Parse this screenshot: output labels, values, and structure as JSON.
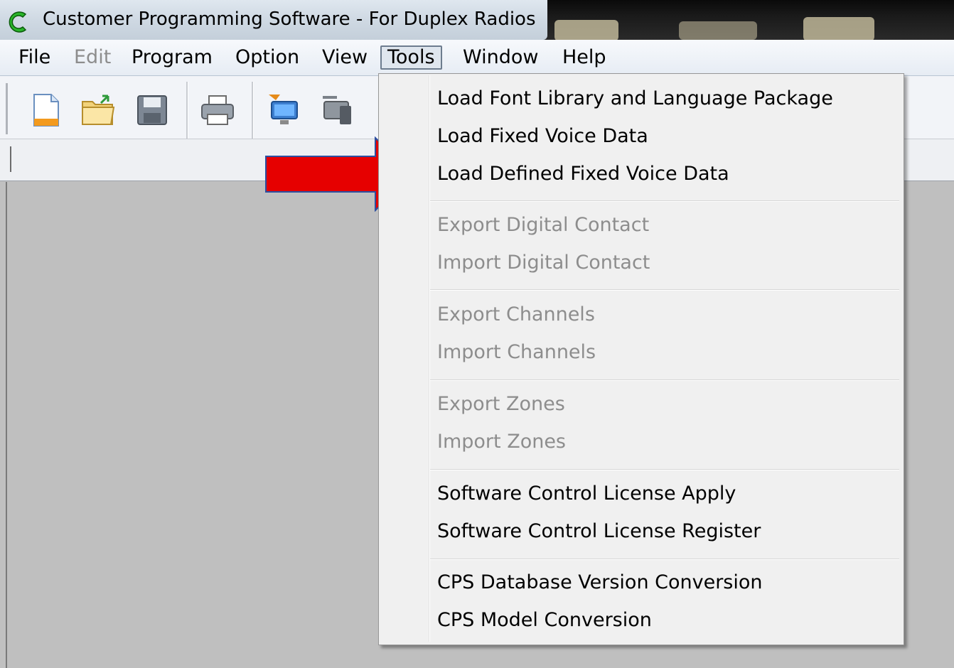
{
  "window": {
    "title": "Customer Programming Software - For Duplex Radios"
  },
  "menubar": {
    "items": [
      {
        "label": "File",
        "enabled": true
      },
      {
        "label": "Edit",
        "enabled": false
      },
      {
        "label": "Program",
        "enabled": true
      },
      {
        "label": "Option",
        "enabled": true
      },
      {
        "label": "View",
        "enabled": true
      },
      {
        "label": "Tools",
        "enabled": true,
        "active": true
      },
      {
        "label": "Window",
        "enabled": true
      },
      {
        "label": "Help",
        "enabled": true
      }
    ]
  },
  "toolbar": {
    "buttons": [
      "new-file-icon",
      "open-folder-icon",
      "save-icon",
      "print-icon",
      "read-from-radio-icon",
      "write-to-radio-icon"
    ]
  },
  "tools_menu": {
    "groups": [
      [
        {
          "label": "Load Font Library and Language Package",
          "enabled": true
        },
        {
          "label": "Load Fixed Voice Data",
          "enabled": true
        },
        {
          "label": "Load Defined Fixed Voice Data",
          "enabled": true
        }
      ],
      [
        {
          "label": "Export Digital Contact",
          "enabled": false
        },
        {
          "label": "Import Digital Contact",
          "enabled": false
        }
      ],
      [
        {
          "label": "Export Channels",
          "enabled": false
        },
        {
          "label": "Import Channels",
          "enabled": false
        }
      ],
      [
        {
          "label": "Export Zones",
          "enabled": false
        },
        {
          "label": "Import Zones",
          "enabled": false
        }
      ],
      [
        {
          "label": "Software Control License Apply",
          "enabled": true
        },
        {
          "label": "Software Control License Register",
          "enabled": true
        }
      ],
      [
        {
          "label": "CPS Database Version Conversion",
          "enabled": true
        },
        {
          "label": "CPS Model Conversion",
          "enabled": true
        }
      ]
    ]
  },
  "annotation": {
    "arrow_color": "#e60000",
    "arrow_outline": "#2c4fa0"
  }
}
